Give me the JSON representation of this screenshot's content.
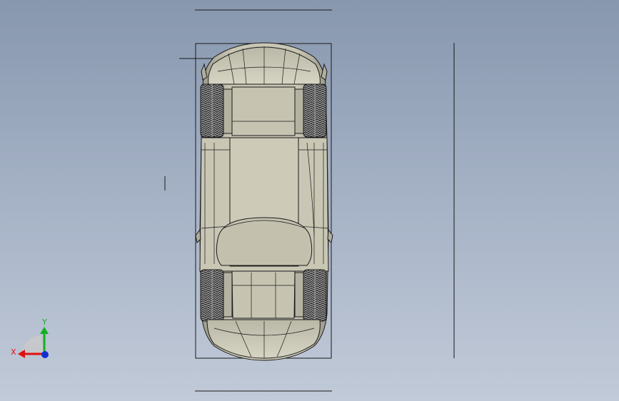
{
  "viewport": {
    "background_top": "#8797ae",
    "background_bottom": "#c1cad8"
  },
  "model": {
    "view": "top",
    "body_color": "#c8c6b2",
    "body_shade": "#a8a796",
    "line_color": "#1a1a1a",
    "tire_color": "#2a2a2a"
  },
  "triad": {
    "x_label": "X",
    "y_label": "Y",
    "x_color": "#e01010",
    "y_color": "#10b020",
    "z_color": "#1030d0"
  }
}
